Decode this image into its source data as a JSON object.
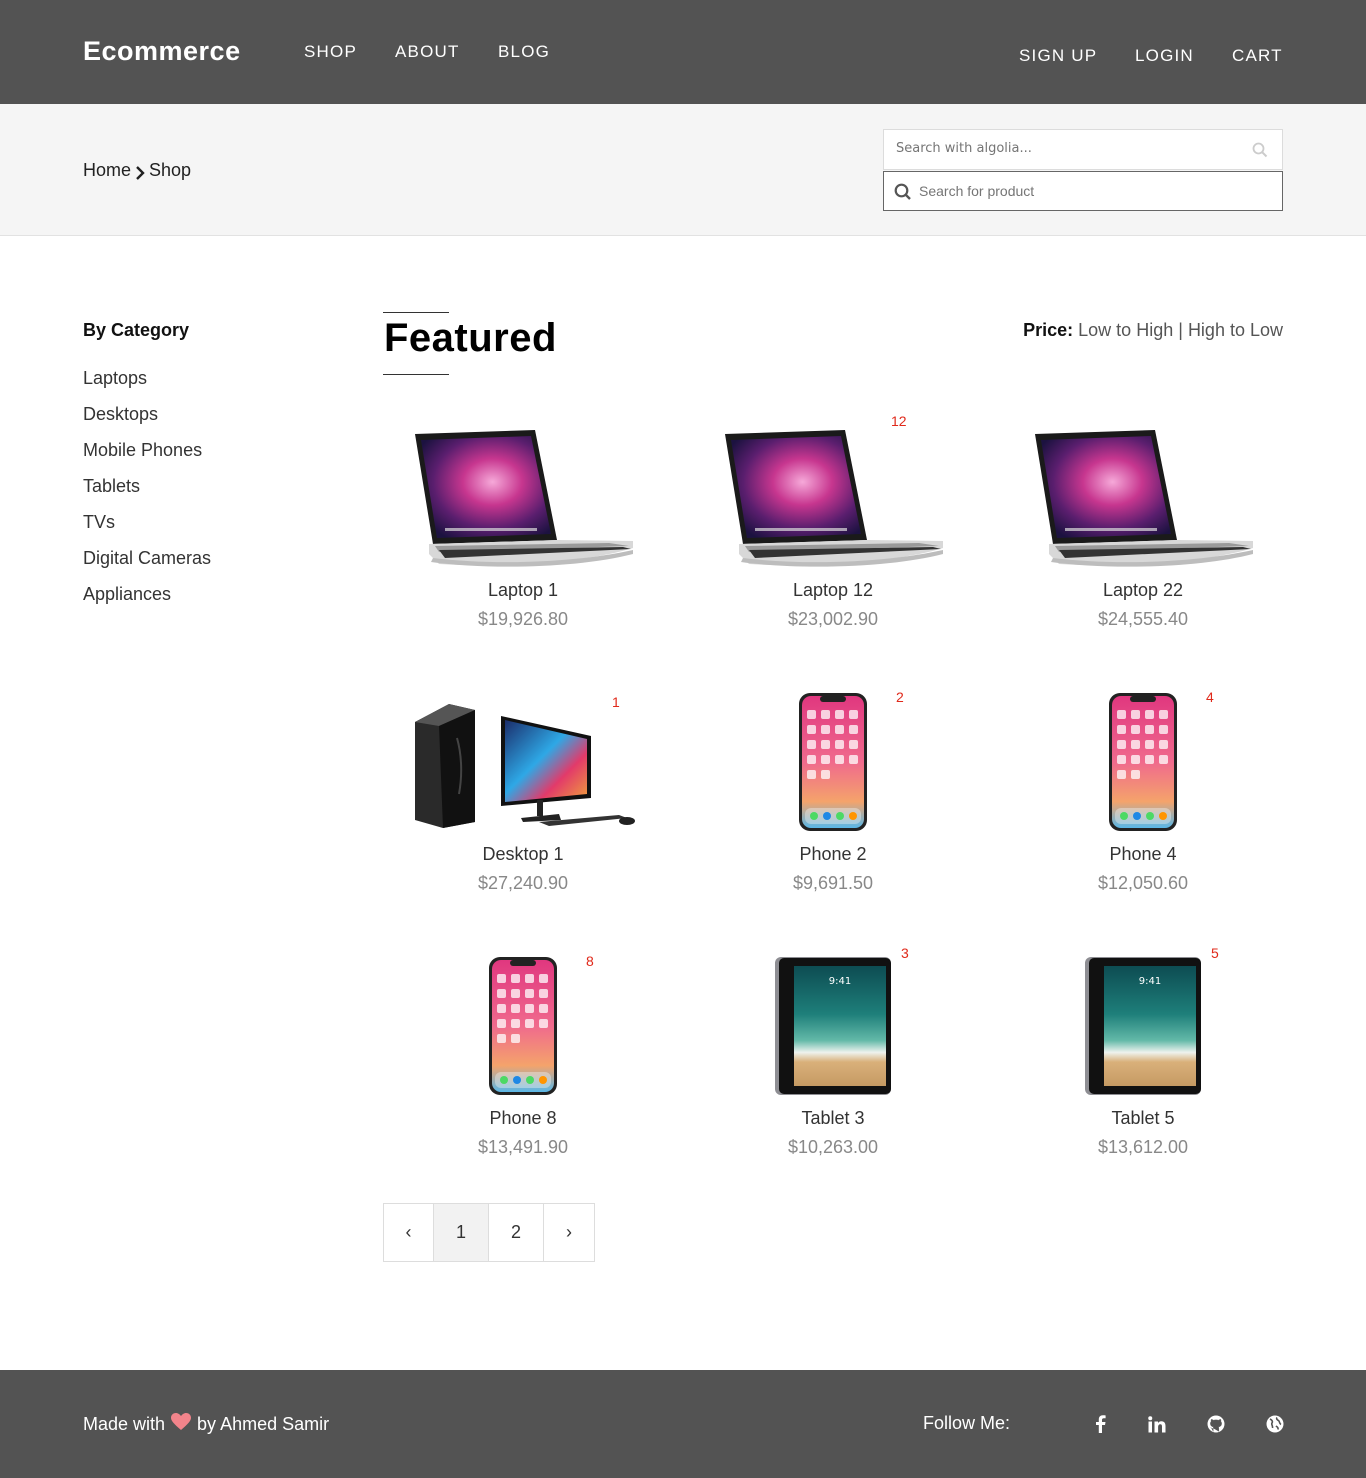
{
  "header": {
    "brand": "Ecommerce",
    "nav_left": [
      "SHOP",
      "ABOUT",
      "BLOG"
    ],
    "nav_right": [
      "SIGN UP",
      "LOGIN",
      "CART"
    ]
  },
  "breadcrumb": {
    "home": "Home",
    "current": "Shop"
  },
  "search": {
    "algolia_placeholder": "Search with algolia...",
    "product_placeholder": "Search for product"
  },
  "sidebar": {
    "title": "By Category",
    "categories": [
      "Laptops",
      "Desktops",
      "Mobile Phones",
      "Tablets",
      "TVs",
      "Digital Cameras",
      "Appliances"
    ]
  },
  "main": {
    "title": "Featured",
    "sort_label": "Price:",
    "sort_low_high": "Low to High",
    "sort_separator": "|",
    "sort_high_low": "High to Low"
  },
  "products": [
    {
      "name": "Laptop 1",
      "price": "$19,926.80",
      "badge": "",
      "icon": "laptop"
    },
    {
      "name": "Laptop 12",
      "price": "$23,002.90",
      "badge": "12",
      "icon": "laptop"
    },
    {
      "name": "Laptop 22",
      "price": "$24,555.40",
      "badge": "",
      "icon": "laptop"
    },
    {
      "name": "Desktop 1",
      "price": "$27,240.90",
      "badge": "1",
      "icon": "desktop"
    },
    {
      "name": "Phone 2",
      "price": "$9,691.50",
      "badge": "2",
      "icon": "phone"
    },
    {
      "name": "Phone 4",
      "price": "$12,050.60",
      "badge": "4",
      "icon": "phone"
    },
    {
      "name": "Phone 8",
      "price": "$13,491.90",
      "badge": "8",
      "icon": "phone"
    },
    {
      "name": "Tablet 3",
      "price": "$10,263.00",
      "badge": "3",
      "icon": "tablet"
    },
    {
      "name": "Tablet 5",
      "price": "$13,612.00",
      "badge": "5",
      "icon": "tablet"
    }
  ],
  "pagination": {
    "prev": "‹",
    "pages": [
      "1",
      "2"
    ],
    "active_page": "1",
    "next": "›"
  },
  "footer": {
    "made_with": "Made with",
    "made_by": "by Ahmed Samir",
    "follow": "Follow Me:",
    "social_icons": [
      "facebook-icon",
      "linkedin-icon",
      "github-icon",
      "globe-icon"
    ]
  },
  "colors": {
    "header_bg": "#535353",
    "subbar_bg": "#f5f5f5",
    "badge": "#e0291a",
    "heart": "#f2848b"
  }
}
